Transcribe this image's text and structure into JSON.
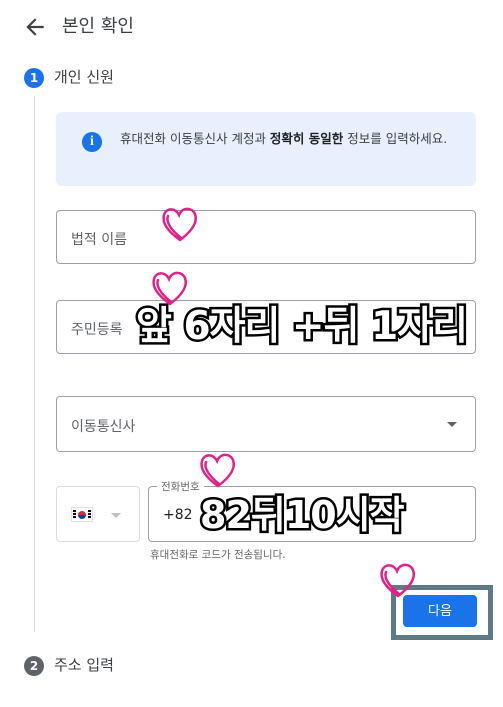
{
  "header": {
    "title": "본인 확인",
    "back_icon": "arrow-back-icon"
  },
  "steps": [
    {
      "number": "1",
      "title": "개인 신원"
    },
    {
      "number": "2",
      "title": "주소 입력"
    }
  ],
  "info": {
    "icon": "info-icon",
    "text_before": "휴대전화 이동통신사 계정과 ",
    "text_bold": "정확히 동일한",
    "text_after": " 정보를 입력하세요."
  },
  "form": {
    "name_placeholder": "법적 이름",
    "rrn_placeholder": "주민등록",
    "carrier_placeholder": "이동통신사",
    "country_flag": "south-korea-flag",
    "phone_label": "전화번호",
    "phone_code": "+82",
    "phone_helper": "휴대전화로 코드가 전송됩니다."
  },
  "actions": {
    "next_label": "다음"
  },
  "annotations": {
    "overlay_1": "앞 6자리 +뒤 1자리",
    "overlay_2": "82뒤10시작",
    "heart_color": "#e0218a"
  },
  "colors": {
    "primary": "#1a73e8",
    "info_bg": "#e8f0fe",
    "highlight_border": "#5f7a85",
    "step_inactive": "#5f6368"
  }
}
